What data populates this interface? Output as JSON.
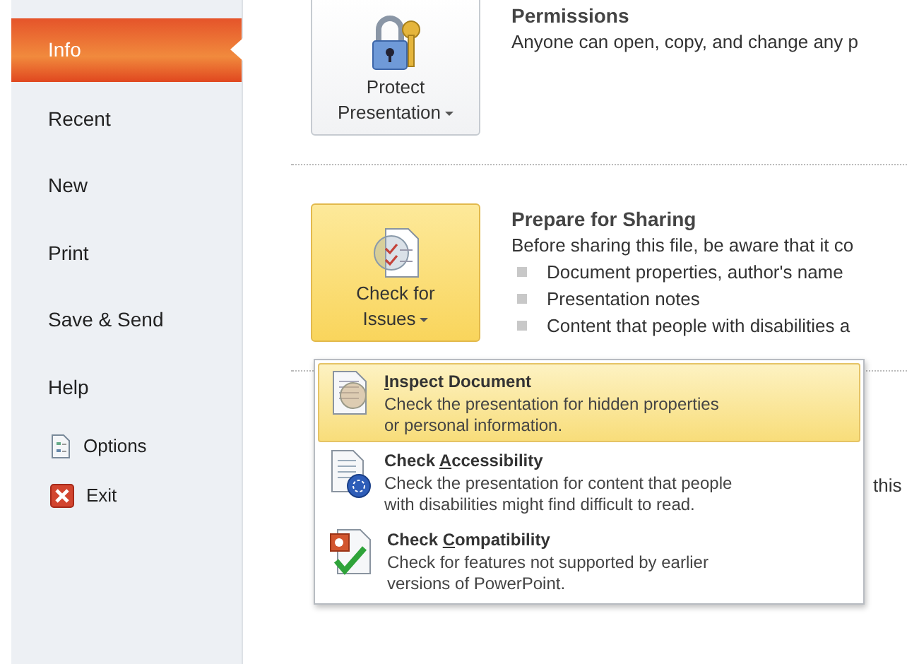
{
  "sidebar": {
    "items": [
      {
        "label": "Info",
        "kind": "tab",
        "selected": true
      },
      {
        "label": "Recent",
        "kind": "tab",
        "selected": false
      },
      {
        "label": "New",
        "kind": "tab",
        "selected": false
      },
      {
        "label": "Print",
        "kind": "tab",
        "selected": false
      },
      {
        "label": "Save & Send",
        "kind": "tab",
        "selected": false
      },
      {
        "label": "Help",
        "kind": "tab",
        "selected": false
      },
      {
        "label": "Options",
        "kind": "options"
      },
      {
        "label": "Exit",
        "kind": "exit"
      }
    ]
  },
  "sections": [
    {
      "button": {
        "kind": "protect",
        "lines": [
          "Protect",
          "Presentation"
        ],
        "hover": false
      },
      "title": "Permissions",
      "description": "Anyone can open, copy, and change any p"
    },
    {
      "button": {
        "kind": "check",
        "lines": [
          "Check for",
          "Issues"
        ],
        "hover": true
      },
      "title": "Prepare for Sharing",
      "description": "Before sharing this file, be aware that it co",
      "bullets": [
        "Document properties, author's name",
        "Presentation notes",
        "Content that people with disabilities a"
      ]
    }
  ],
  "peek_text": "this",
  "dropdown": {
    "items": [
      {
        "kind": "inspect",
        "label_parts": {
          "key": "I",
          "after": "nspect Document"
        },
        "description": "Check the presentation for hidden properties\nor personal information.",
        "selected": true
      },
      {
        "kind": "accessibility",
        "label_parts": {
          "before": "Check ",
          "key": "A",
          "after": "ccessibility"
        },
        "description": "Check the presentation for content that people\nwith disabilities might find difficult to read.",
        "selected": false
      },
      {
        "kind": "compatibility",
        "label_parts": {
          "before": "Check ",
          "key": "C",
          "after": "ompatibility"
        },
        "description": "Check for features not supported by earlier\nversions of PowerPoint.",
        "selected": false
      }
    ]
  }
}
